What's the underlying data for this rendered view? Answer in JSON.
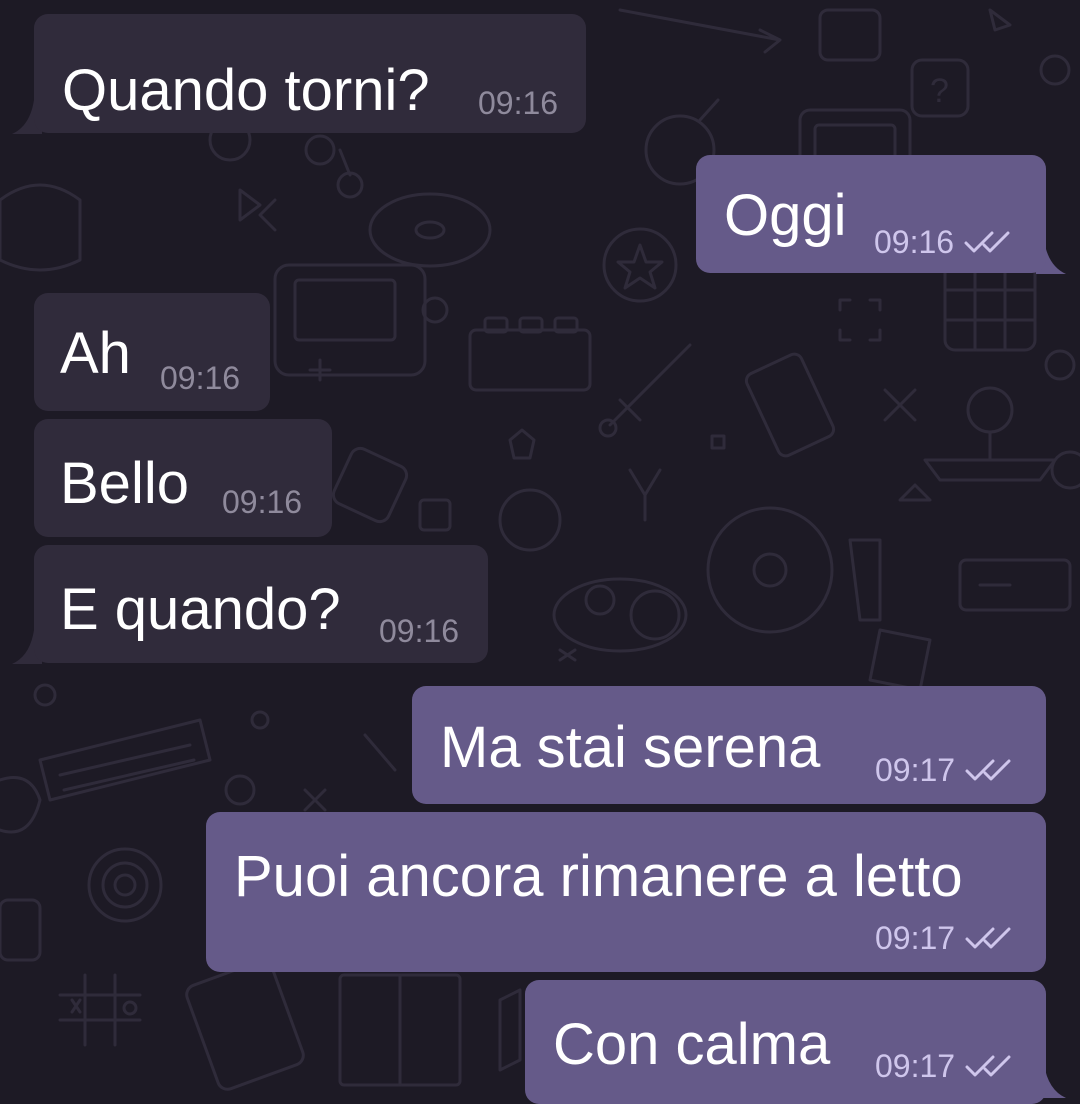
{
  "theme": {
    "background": "#1d1a25",
    "incoming_bubble": "#302b3b",
    "outgoing_bubble": "#655a89",
    "incoming_time": "#8f8a9c",
    "outgoing_time": "#cfc6ec",
    "read_check": "#cfc6ec"
  },
  "messages": [
    {
      "direction": "incoming",
      "text": "Quando torni?",
      "time": "09:16"
    },
    {
      "direction": "outgoing",
      "text": "Oggi",
      "time": "09:16",
      "status_icon": "double-check-icon"
    },
    {
      "direction": "incoming",
      "text": "Ah",
      "time": "09:16"
    },
    {
      "direction": "incoming",
      "text": "Bello",
      "time": "09:16"
    },
    {
      "direction": "incoming",
      "text": "E quando?",
      "time": "09:16"
    },
    {
      "direction": "outgoing",
      "text": "Ma stai serena",
      "time": "09:17",
      "status_icon": "double-check-icon"
    },
    {
      "direction": "outgoing",
      "text": "Puoi ancora rimanere a letto",
      "time": "09:17",
      "status_icon": "double-check-icon"
    },
    {
      "direction": "outgoing",
      "text": "Con calma",
      "time": "09:17",
      "status_icon": "double-check-icon"
    }
  ]
}
